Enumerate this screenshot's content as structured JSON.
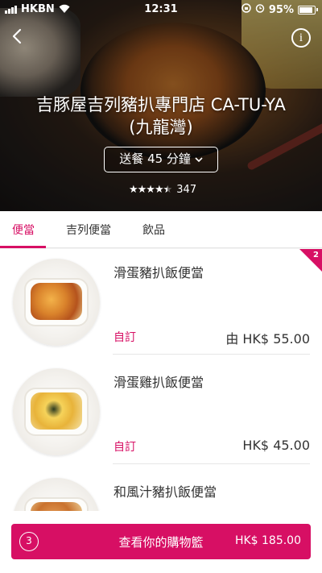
{
  "status_bar": {
    "carrier": "HKBN",
    "time": "12:31",
    "battery": "95%",
    "battery_level": 0.95
  },
  "store": {
    "name_line1": "吉豚屋吉列豬扒專門店 CA-TU-YA",
    "name_line2": "(九龍灣)",
    "delivery": "送餐 45 分鐘",
    "rating_stars": 4.5,
    "rating_count": "347"
  },
  "tabs": [
    {
      "label": "便當",
      "active": true
    },
    {
      "label": "吉列便當",
      "active": false
    },
    {
      "label": "飲品",
      "active": false
    }
  ],
  "corner_badge": "2",
  "menu_items": [
    {
      "name": "滑蛋豬扒飯便當",
      "tag": "自訂",
      "price": "由 HK$ 55.00"
    },
    {
      "name": "滑蛋雞扒飯便當",
      "tag": "自訂",
      "price": "HK$ 45.00"
    },
    {
      "name": "和風汁豬扒飯便當",
      "tag": "",
      "price": ""
    }
  ],
  "cart": {
    "count": "3",
    "label": "查看你的購物籃",
    "total": "HK$ 185.00"
  },
  "colors": {
    "brand": "#d70f64",
    "text": "#333333"
  },
  "icons": {
    "back": "chevron-left-icon",
    "info": "info-icon",
    "dropdown": "chevron-down-icon",
    "alarm": "alarm-icon",
    "lock": "rotation-lock-icon"
  }
}
